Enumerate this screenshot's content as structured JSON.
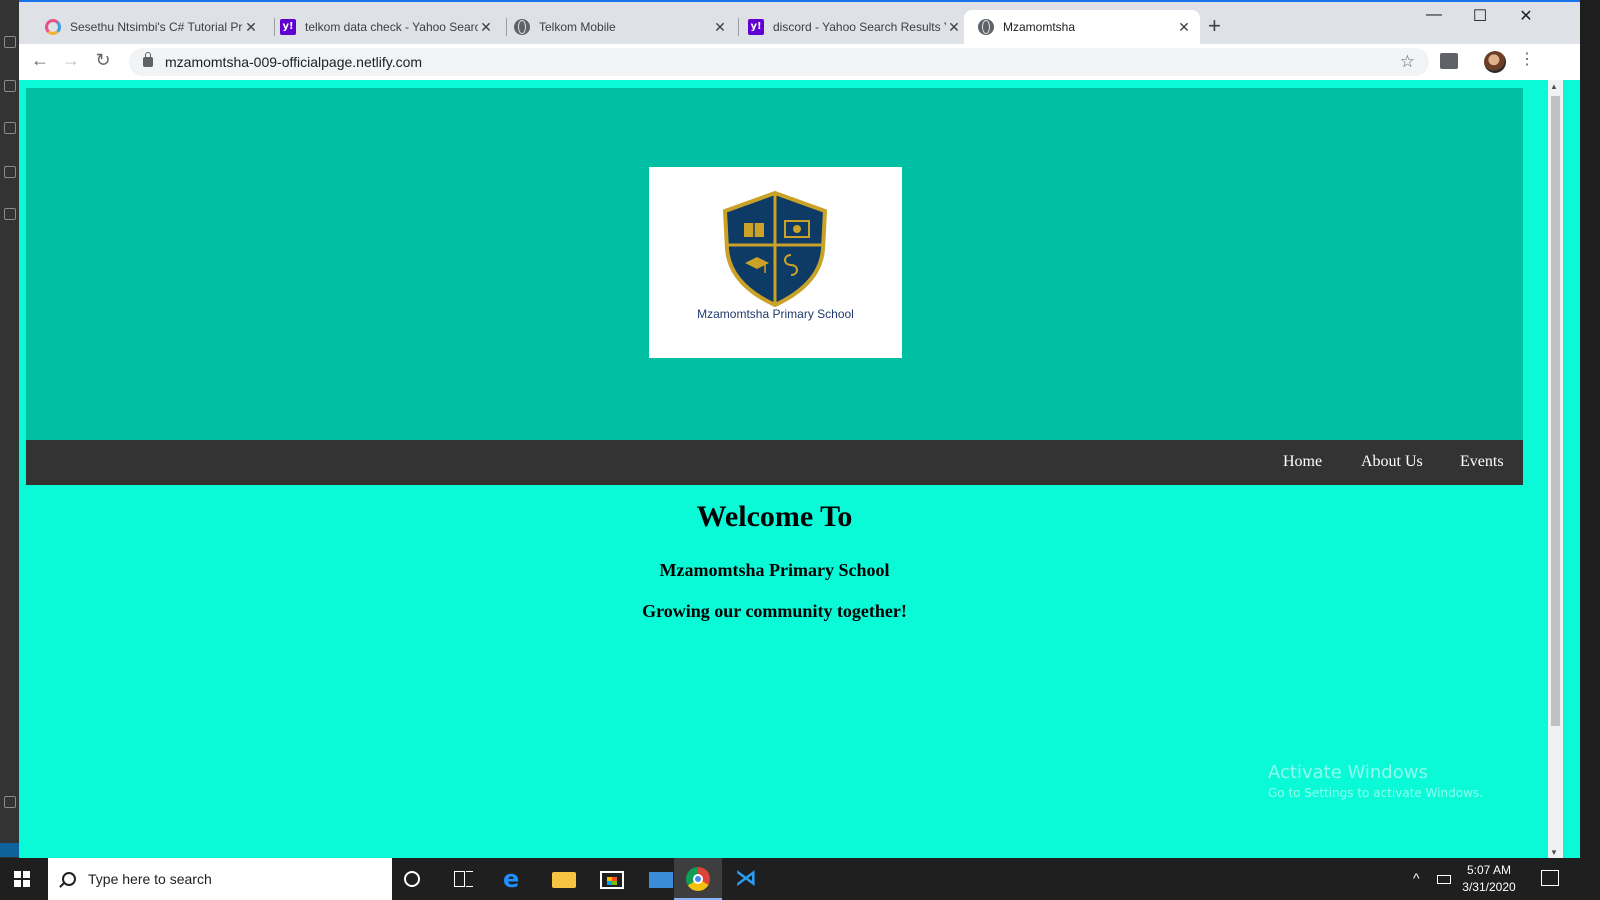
{
  "tabs": [
    {
      "title": "Sesethu Ntsimbi's C# Tutorial Pro",
      "icon": "site-ring-icon"
    },
    {
      "title": "telkom data check - Yahoo Search",
      "icon": "yahoo-icon"
    },
    {
      "title": "Telkom Mobile",
      "icon": "globe-icon"
    },
    {
      "title": "discord - Yahoo Search Results Ya",
      "icon": "yahoo-icon"
    },
    {
      "title": "Mzamomtsha",
      "icon": "globe-icon"
    }
  ],
  "tab_close_glyph": "✕",
  "yahoo_glyph": "y!",
  "new_tab_glyph": "+",
  "window_controls": {
    "minimize": "—",
    "maximize": "☐",
    "close": "✕"
  },
  "toolbar": {
    "back": "←",
    "forward": "→",
    "reload": "↻",
    "menu": "⋮",
    "star": "☆"
  },
  "address": "mzamomtsha-009-officialpage.netlify.com",
  "site": {
    "logo_caption": "Mzamomtsha Primary School",
    "nav": [
      "Home",
      "About Us",
      "Events"
    ],
    "heading": "Welcome To",
    "school_name": "Mzamomtsha Primary School",
    "slogan": "Growing our community together!"
  },
  "watermark": {
    "line1": "Activate Windows",
    "line2": "Go to Settings to activate Windows."
  },
  "taskbar": {
    "search_placeholder": "Type here to search",
    "edge_glyph": "e",
    "vscode_glyph": "⋊",
    "time": "5:07 AM",
    "date": "3/31/2020"
  },
  "colors": {
    "hero_bg": "#00bfa2",
    "page_bg": "#0afad8",
    "nav_bg": "#333333",
    "shield_navy": "#0d3b66",
    "shield_gold": "#c9a227"
  }
}
